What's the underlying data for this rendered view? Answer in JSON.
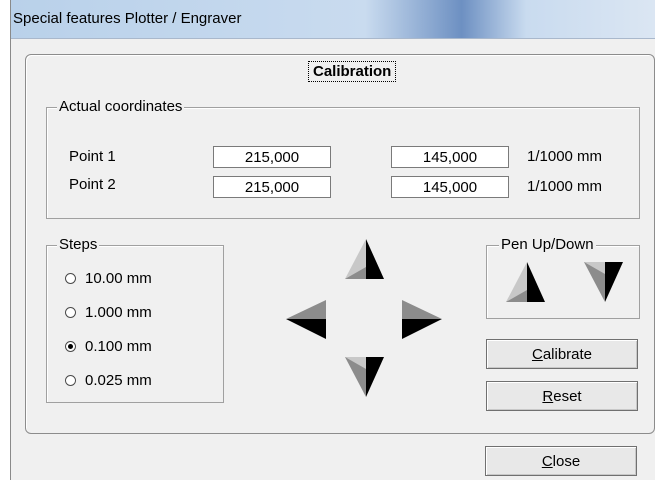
{
  "window": {
    "title": "Special features Plotter / Engraver"
  },
  "tab": {
    "label": "Calibration"
  },
  "coordinates": {
    "legend": "Actual coordinates",
    "rows": [
      {
        "label": "Point 1",
        "x": "215,000",
        "y": "145,000",
        "unit": "1/1000 mm"
      },
      {
        "label": "Point 2",
        "x": "215,000",
        "y": "145,000",
        "unit": "1/1000 mm"
      }
    ]
  },
  "steps": {
    "legend": "Steps",
    "options": [
      "10.00 mm",
      "1.000 mm",
      "0.100 mm",
      "0.025 mm"
    ],
    "selected": "0.100 mm"
  },
  "pen": {
    "legend": "Pen Up/Down"
  },
  "buttons": {
    "calibrate": {
      "accel": "C",
      "rest": "alibrate"
    },
    "reset": {
      "accel": "R",
      "rest": "eset"
    },
    "close": {
      "accel": "C",
      "rest": "lose"
    }
  },
  "icons": {
    "up": "arrow-up-icon",
    "down": "arrow-down-icon",
    "left": "arrow-left-icon",
    "right": "arrow-right-icon",
    "pen_up": "pen-up-icon",
    "pen_down": "pen-down-icon"
  }
}
